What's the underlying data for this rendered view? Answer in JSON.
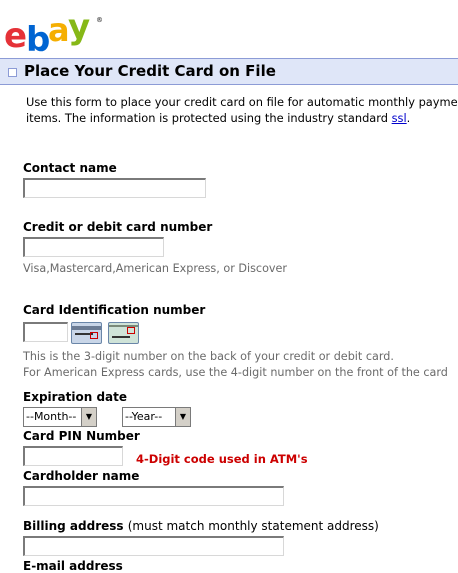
{
  "logo": {
    "text": "ebay",
    "letters": [
      "e",
      "b",
      "a",
      "y"
    ],
    "registered": "®",
    "colors": [
      "#e53238",
      "#0064d2",
      "#f5af02",
      "#86b817"
    ]
  },
  "header": {
    "title": "Place Your Credit Card on File"
  },
  "intro": {
    "line1": "Use this form to place your credit card on file for automatic monthly payme",
    "line2_before": "items. The information is protected using the industry standard ",
    "link": "ssl",
    "line2_after": "."
  },
  "fields": {
    "contact_name": {
      "label": "Contact name",
      "value": ""
    },
    "card_number": {
      "label": "Credit or debit card number",
      "value": "",
      "hint": "Visa,Mastercard,American Express, or Discover"
    },
    "card_id": {
      "label": "Card Identification number",
      "value": "",
      "hint_line1": "This is the 3-digit number on the back of your credit or debit card.",
      "hint_line2": "For American Express cards, use the 4-digit number on the front of the card",
      "card_icons": [
        "card-back-icon",
        "amex-card-front-icon"
      ]
    },
    "expiration": {
      "label": "Expiration date",
      "month": "--Month--",
      "year": "--Year--"
    },
    "pin": {
      "label": "Card PIN Number",
      "value": "",
      "note": "4-Digit code used in ATM's"
    },
    "cardholder": {
      "label": "Cardholder name",
      "value": ""
    },
    "billing": {
      "label": "Billing address",
      "label_note": "(must match monthly statement address)",
      "value": ""
    },
    "email": {
      "label": "E-mail address"
    }
  }
}
